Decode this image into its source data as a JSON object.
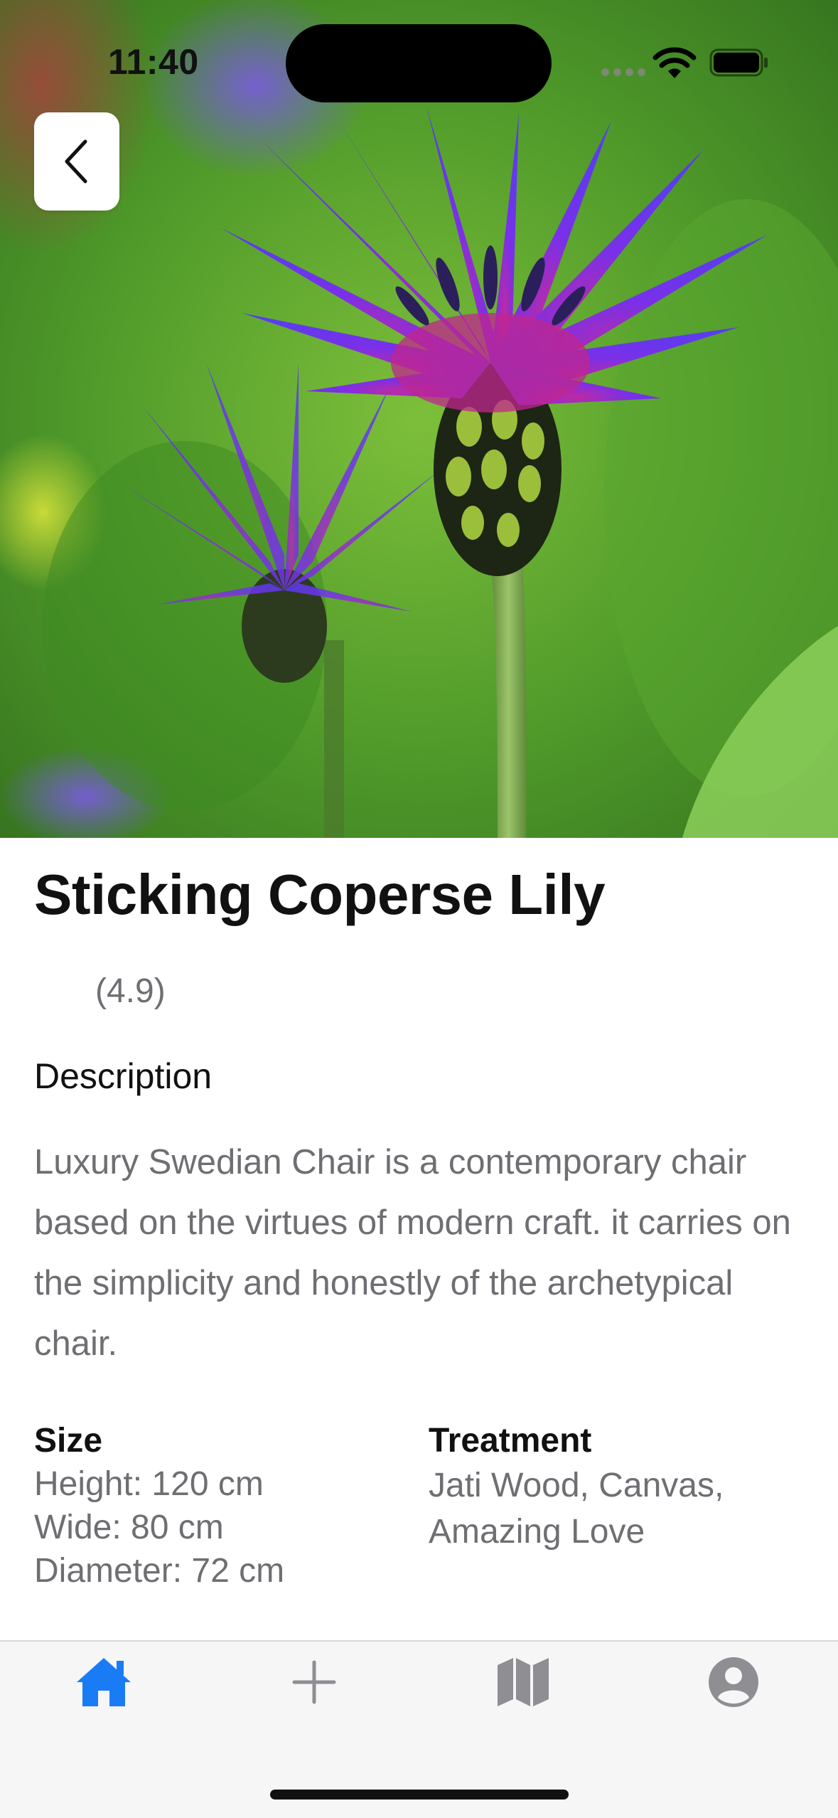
{
  "status_bar": {
    "time": "11:40"
  },
  "hero": {
    "image": "cornflower-photo",
    "colors": {
      "petal": "#6a2ee0",
      "leaf": "#4a9a2a"
    }
  },
  "header": {
    "back_icon": "chevron-left-icon"
  },
  "product": {
    "title": "Sticking Coperse Lily",
    "rating": "(4.9)",
    "description_heading": "Description",
    "description": "Luxury Swedian Chair is a contemporary chair based on the virtues of modern craft. it carries on the simplicity and honestly of the archetypical chair.",
    "size": {
      "heading": "Size",
      "lines": [
        "Height: 120 cm",
        "Wide: 80 cm",
        "Diameter: 72 cm"
      ]
    },
    "treatment": {
      "heading": "Treatment",
      "lines": [
        "Jati Wood, Canvas,",
        "Amazing Love"
      ]
    }
  },
  "tab_bar": {
    "accent": "#1a7cf5",
    "inactive": "#8e8e93",
    "tabs": [
      {
        "icon": "home-icon",
        "active": true
      },
      {
        "icon": "plus-icon",
        "active": false
      },
      {
        "icon": "map-icon",
        "active": false
      },
      {
        "icon": "profile-icon",
        "active": false
      }
    ]
  }
}
